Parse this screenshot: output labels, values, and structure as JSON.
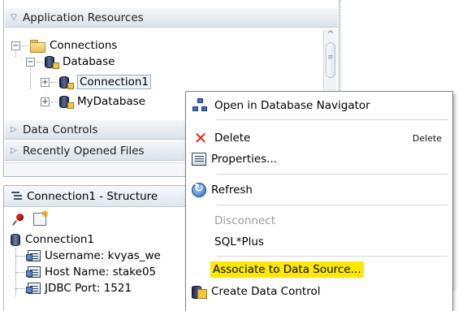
{
  "app_resources": {
    "title": "Application Resources",
    "tree": {
      "connections_label": "Connections",
      "database_label": "Database",
      "connection1_label": "Connection1",
      "mydatabase_label": "MyDatabase"
    },
    "sections": {
      "data_controls": "Data Controls",
      "recently_opened": "Recently Opened Files"
    }
  },
  "structure": {
    "title": "Connection1 - Structure",
    "root_label": "Connection1",
    "rows": [
      "Username: kvyas_we",
      "Host Name: stake05",
      "JDBC Port: 1521"
    ]
  },
  "context_menu": {
    "items": [
      {
        "label": "Open in Database Navigator",
        "icon": "database-navigator-icon",
        "enabled": true
      },
      {
        "label": "Delete",
        "shortcut": "Delete",
        "icon": "delete-icon",
        "enabled": true
      },
      {
        "label": "Properties...",
        "icon": "properties-icon",
        "enabled": true
      },
      {
        "label": "Refresh",
        "icon": "refresh-icon",
        "enabled": true
      },
      {
        "label": "Disconnect",
        "enabled": false
      },
      {
        "label": "SQL*Plus",
        "enabled": true
      },
      {
        "label": "Associate to Data Source...",
        "enabled": true,
        "highlighted": true
      },
      {
        "label": "Create Data Control",
        "icon": "data-control-icon",
        "enabled": true
      }
    ]
  },
  "colors": {
    "highlight": "#ffe800",
    "delete": "#e02717",
    "border": "#7a8696"
  }
}
